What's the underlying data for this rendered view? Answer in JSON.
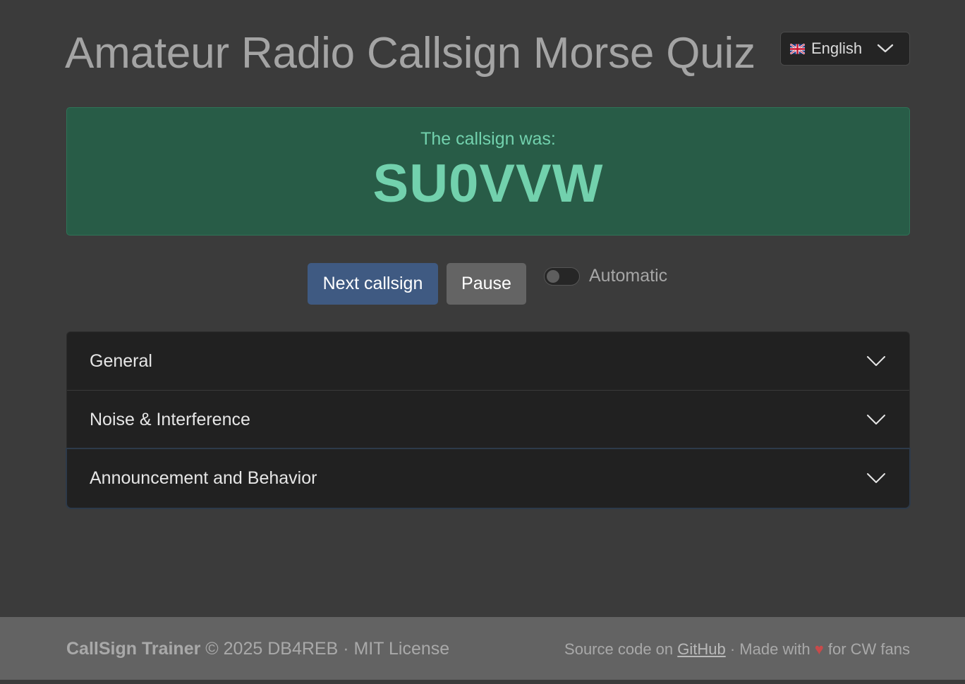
{
  "header": {
    "title": "Amateur Radio Callsign Morse Quiz",
    "language": {
      "flag_icon": "uk-flag-icon",
      "selected": "English",
      "chevron_icon": "chevron-down-icon"
    }
  },
  "result": {
    "label": "The callsign was:",
    "callsign": "SU0VVW",
    "color": "#72d1ad",
    "background": "#285c47"
  },
  "controls": {
    "next_label": "Next callsign",
    "pause_label": "Pause",
    "automatic_label": "Automatic",
    "automatic_enabled": false,
    "accent": "#3f5a82"
  },
  "accordion": {
    "items": [
      {
        "label": "General",
        "icon": "chevron-down-icon"
      },
      {
        "label": "Noise & Interference",
        "icon": "chevron-down-icon"
      },
      {
        "label": "Announcement and Behavior",
        "icon": "chevron-down-icon"
      }
    ]
  },
  "footer": {
    "brand": "CallSign Trainer",
    "copyright": " © 2025 DB4REB · MIT License",
    "source_prefix": "Source code on ",
    "github_link": "GitHub",
    "made_with": " · Made with ",
    "heart": "♥",
    "for_fans": " for CW fans"
  }
}
